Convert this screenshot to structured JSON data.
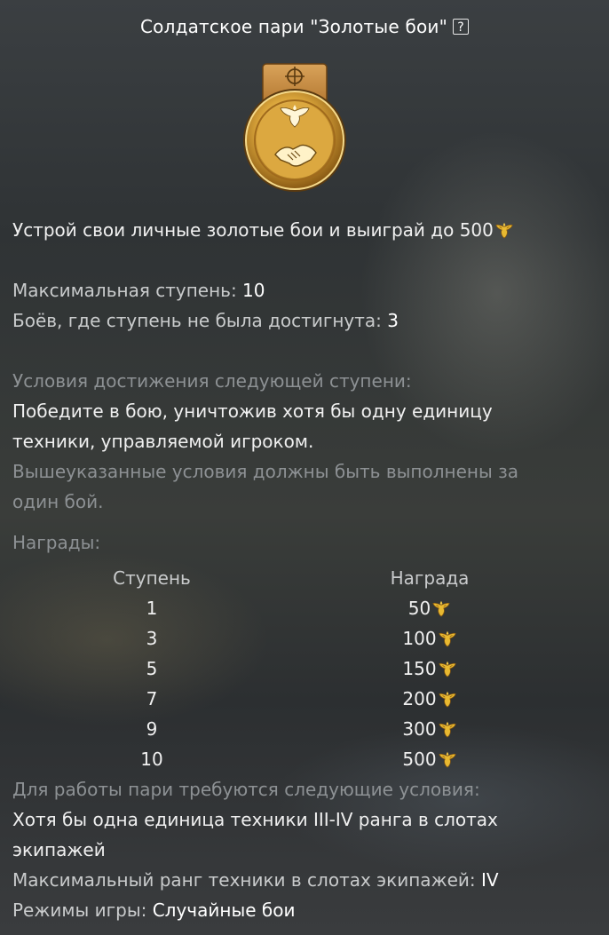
{
  "title": "Солдатское пари \"Золотые бои\"",
  "help_icon": "?",
  "description": "Устрой свои личные золотые бои и выиграй до 500",
  "currency_icon": "golden-eagle-icon",
  "stats": {
    "max_stage_label": "Максимальная ступень:",
    "max_stage_value": "10",
    "failed_label": "Боёв, где ступень не была достигнута:",
    "failed_value": "3"
  },
  "conditions": {
    "heading": "Условия достижения следующей ступени:",
    "line1": "Победите в бою, уничтожив хотя бы одну единицу",
    "line2": "техники, управляемой игроком.",
    "note1": "Вышеуказанные условия должны быть выполнены за",
    "note2": "один бой."
  },
  "rewards": {
    "heading": "Награды:",
    "col_stage": "Ступень",
    "col_reward": "Награда",
    "rows": [
      {
        "stage": "1",
        "reward": "50"
      },
      {
        "stage": "3",
        "reward": "100"
      },
      {
        "stage": "5",
        "reward": "150"
      },
      {
        "stage": "7",
        "reward": "200"
      },
      {
        "stage": "9",
        "reward": "300"
      },
      {
        "stage": "10",
        "reward": "500"
      }
    ]
  },
  "requirements": {
    "heading": "Для работы пари требуются следующие условия:",
    "line1": "Хотя бы одна единица техники III-IV ранга в слотах",
    "line2": "экипажей",
    "max_rank_label": "Максимальный ранг техники в слотах экипажей:",
    "max_rank_value": "IV",
    "modes_label": "Режимы игры:",
    "modes_value": "Случайные бои"
  },
  "colors": {
    "gold": "#e8b931",
    "gray_text": "#8d9194"
  }
}
